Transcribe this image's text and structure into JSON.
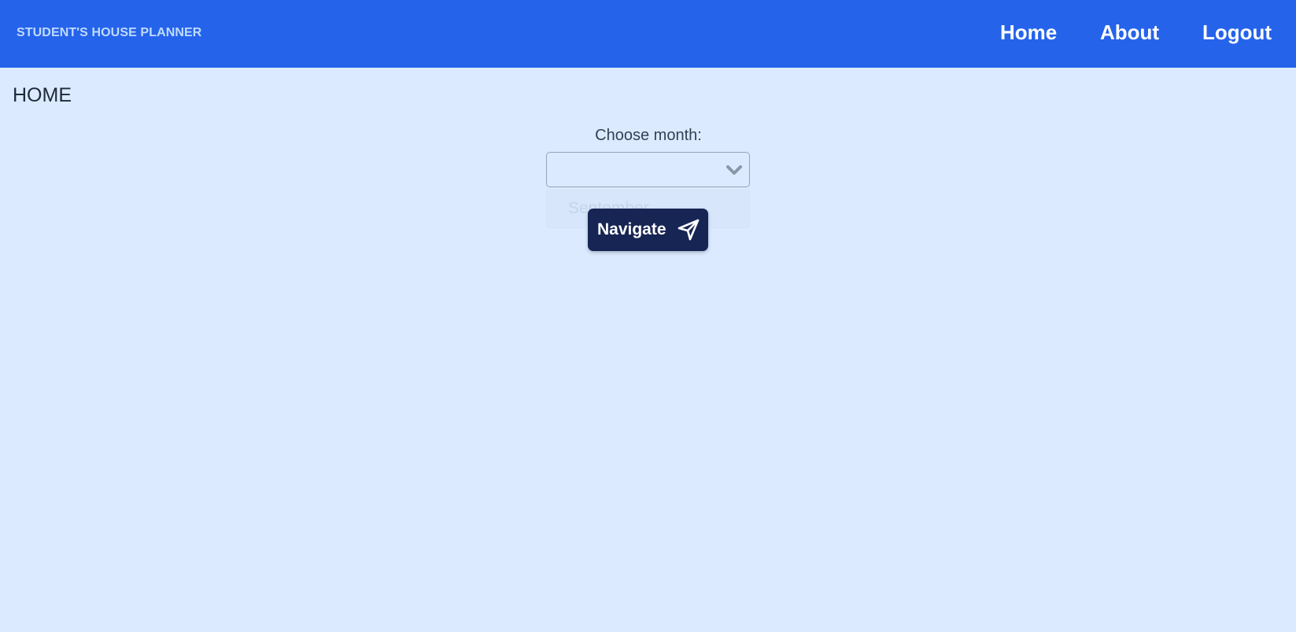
{
  "header": {
    "brand": "STUDENT'S HOUSE PLANNER",
    "nav": {
      "home": "Home",
      "about": "About",
      "logout": "Logout"
    }
  },
  "main": {
    "title": "HOME",
    "month_label": "Choose month:",
    "month_select": {
      "value": "",
      "options": [
        "September"
      ]
    },
    "navigate_button": "Navigate"
  },
  "icons": {
    "select_arrow": "chevron-down-icon",
    "navigate": "send-icon"
  },
  "colors": {
    "navbar": "#2563eb",
    "background": "#dbeafe",
    "button": "#172554",
    "brand_text": "#bfdbfe"
  }
}
